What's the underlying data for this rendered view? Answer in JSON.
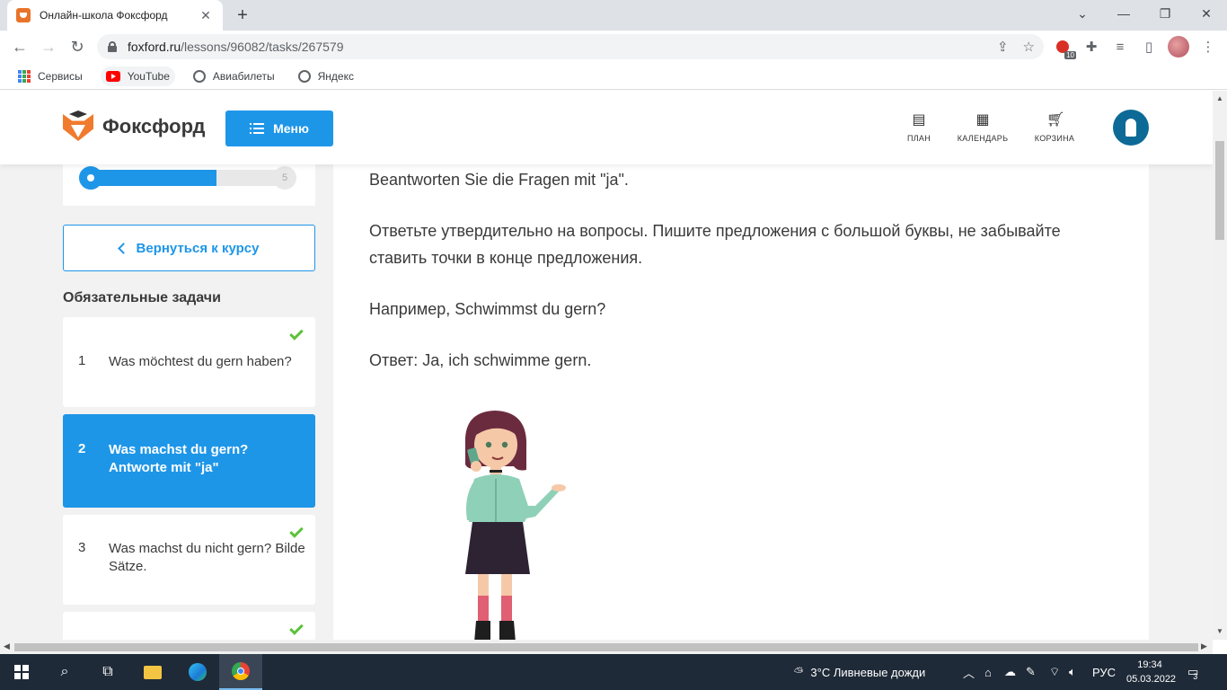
{
  "browser": {
    "tab_title": "Онлайн-школа Фоксфорд",
    "url_host": "foxford.ru",
    "url_path": "/lessons/96082/tasks/267579",
    "ext_badge": "10",
    "bookmarks": [
      {
        "label": "Сервисы",
        "icon": "apps-grid-icon"
      },
      {
        "label": "YouTube",
        "icon": "youtube-icon"
      },
      {
        "label": "Авиабилеты",
        "icon": "globe-icon"
      },
      {
        "label": "Яндекс",
        "icon": "globe-icon"
      }
    ]
  },
  "header": {
    "logo_text": "Фоксфорд",
    "menu_label": "Меню",
    "nav": [
      {
        "label": "ПЛАН",
        "icon": "plan-icon"
      },
      {
        "label": "КАЛЕНДАРЬ",
        "icon": "calendar-icon"
      },
      {
        "label": "КОРЗИНА",
        "icon": "cart-icon"
      }
    ]
  },
  "sidebar": {
    "progress": {
      "current_fraction": 0.63,
      "end_label": "5"
    },
    "back_label": "Вернуться к курсу",
    "section_title": "Обязательные задачи",
    "tasks": [
      {
        "num": "1",
        "text": "Was möchtest du gern haben?",
        "done": true,
        "active": false
      },
      {
        "num": "2",
        "text": "Was machst du gern? Antworte mit \"ja\"",
        "done": false,
        "active": true
      },
      {
        "num": "3",
        "text": "Was machst du nicht gern? Bilde Sätze.",
        "done": true,
        "active": false
      },
      {
        "num": "",
        "text": "",
        "done": true,
        "active": false
      }
    ]
  },
  "content": {
    "line1": "Beantworten Sie die Fragen mit \"ja\".",
    "line2": "Ответьте утвердительно на вопросы. Пишите предложения с большой буквы, не забывайте ставить точки в конце предложения.",
    "line3": "Например, Schwimmst du gern?",
    "line4": "Ответ: Ja, ich schwimme gern."
  },
  "taskbar": {
    "weather": "3°C  Ливневые дожди",
    "lang": "РУС",
    "time": "19:34",
    "date": "05.03.2022",
    "notification_count": "3"
  },
  "colors": {
    "accent": "#1e96e8",
    "check": "#5cc23a",
    "text": "#3a3a3a",
    "avatar": "#0d6a96"
  }
}
